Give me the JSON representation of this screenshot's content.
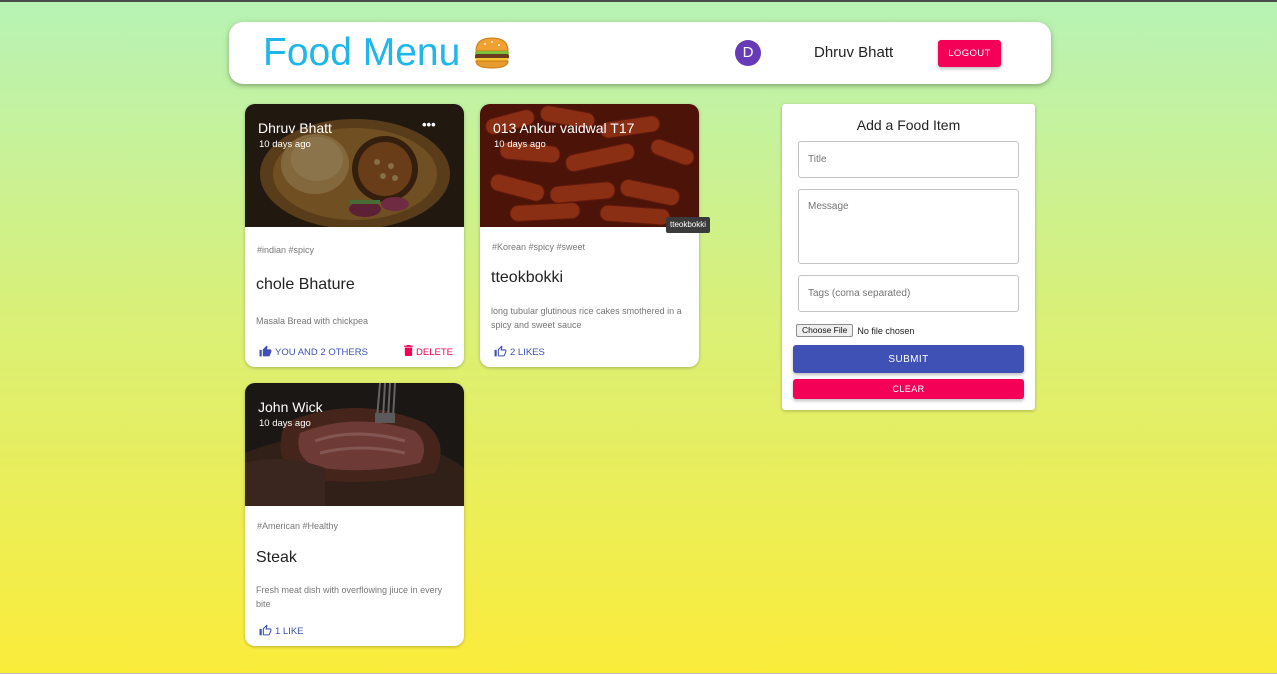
{
  "header": {
    "brand": "Food Menu",
    "brand_icon": "burger-icon",
    "avatar_initial": "D",
    "user_name": "Dhruv Bhatt",
    "logout_label": "Logout"
  },
  "posts": [
    {
      "author": "Dhruv Bhatt",
      "time": "10 days ago",
      "tags": "#indian #spicy",
      "title": "chole Bhature",
      "message": "Masala Bread with chickpea",
      "likes": "You and 2 others",
      "delete_label": "Delete",
      "image": "chole-bhature-photo"
    },
    {
      "author": "013 Ankur vaidwal T17",
      "time": "10 days ago",
      "tags": "#Korean #spicy #sweet",
      "title": "tteokbokki",
      "message": "long tubular glutinous rice cakes smothered in a spicy and sweet sauce",
      "likes": "2 Likes",
      "image": "tteokbokki-photo",
      "tooltip": "tteokbokki"
    },
    {
      "author": "John Wick",
      "time": "10 days ago",
      "tags": "#American #Healthy",
      "title": "Steak",
      "message": "Fresh meat dish with overflowing jiuce in every bite",
      "likes": "1 Like",
      "image": "steak-photo"
    }
  ],
  "form": {
    "heading": "Add a Food Item",
    "title_placeholder": "Title",
    "message_placeholder": "Message",
    "tags_placeholder": "Tags (coma separated)",
    "file_button": "Choose File",
    "file_status": "No file chosen",
    "submit_label": "Submit",
    "clear_label": "Clear"
  },
  "colors": {
    "brand": "#1fb6ea",
    "primary": "#3f51b5",
    "secondary": "#f50057",
    "avatar": "#673ab7"
  }
}
